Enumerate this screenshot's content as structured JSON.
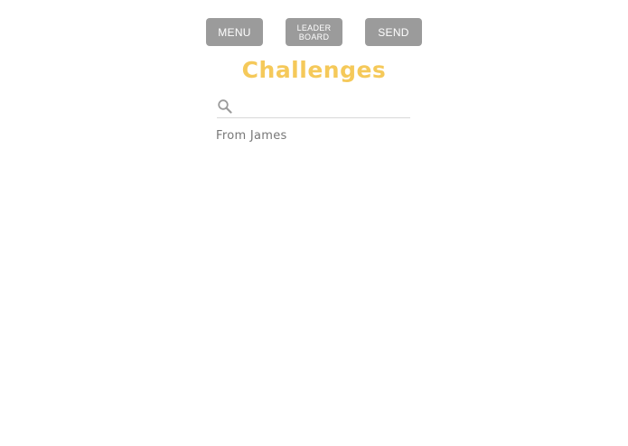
{
  "toolbar": {
    "menu_label": "MENU",
    "leader_label_line1": "LEADER",
    "leader_label_line2": "BOARD",
    "send_label": "SEND"
  },
  "page": {
    "title": "Challenges"
  },
  "search": {
    "value": "",
    "placeholder": "",
    "icon": "search-icon"
  },
  "challenges": [
    {
      "label": "From James"
    }
  ],
  "colors": {
    "button_bg": "#9b9b9b",
    "button_text": "#ffffff",
    "title": "#f5c95a",
    "list_text": "#777777"
  }
}
